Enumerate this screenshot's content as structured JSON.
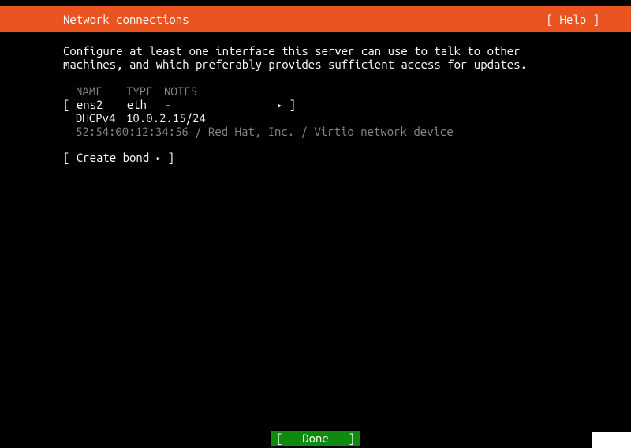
{
  "header": {
    "title": "Network connections",
    "help_label": "[ Help ]"
  },
  "description": "Configure at least one interface this server can use to talk to other machines, and which preferably provides sufficient access for updates.",
  "table": {
    "headers": {
      "name": "NAME",
      "type": "TYPE",
      "notes": "NOTES"
    },
    "interface": {
      "name": "ens2",
      "type": "eth",
      "notes": "-",
      "dhcp_label": "DHCPv4",
      "ip": "10.0.2.15/24",
      "info": "52:54:00:12:34:56 / Red Hat, Inc. / Virtio network device"
    }
  },
  "actions": {
    "create_bond": "Create bond"
  },
  "footer": {
    "done_label": "Done"
  },
  "brackets": {
    "open": "[",
    "close": "]"
  },
  "arrow": "▸"
}
